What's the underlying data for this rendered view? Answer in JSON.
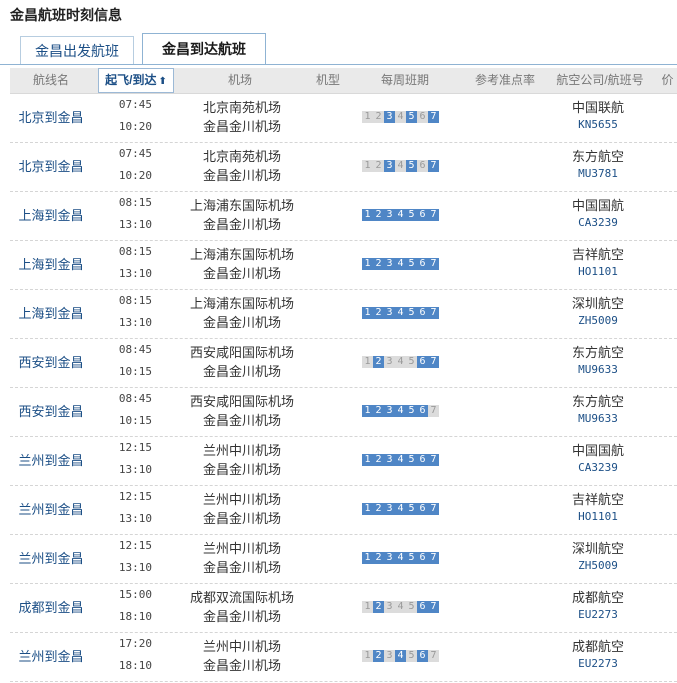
{
  "page_title": "金昌航班时刻信息",
  "tabs": [
    {
      "label": "金昌出发航班",
      "active": false
    },
    {
      "label": "金昌到达航班",
      "active": true
    }
  ],
  "columns": {
    "route": "航线名",
    "time": "起飞/到达",
    "airport": "机场",
    "plane": "机型",
    "weekly": "每周班期",
    "ontime": "参考准点率",
    "airline": "航空公司/航班号",
    "extra": "价"
  },
  "colors": {
    "accent": "#1c4f86",
    "day_on": "#4f86c6",
    "day_off": "#dcdcdc"
  },
  "flights": [
    {
      "route": "北京到金昌",
      "dep": "07:45",
      "arr": "10:20",
      "dep_airport": "北京南苑机场",
      "arr_airport": "金昌金川机场",
      "days": [
        0,
        0,
        1,
        0,
        1,
        0,
        1
      ],
      "airline": "中国联航",
      "flight_no": "KN5655"
    },
    {
      "route": "北京到金昌",
      "dep": "07:45",
      "arr": "10:20",
      "dep_airport": "北京南苑机场",
      "arr_airport": "金昌金川机场",
      "days": [
        0,
        0,
        1,
        0,
        1,
        0,
        1
      ],
      "airline": "东方航空",
      "flight_no": "MU3781"
    },
    {
      "route": "上海到金昌",
      "dep": "08:15",
      "arr": "13:10",
      "dep_airport": "上海浦东国际机场",
      "arr_airport": "金昌金川机场",
      "days": [
        1,
        1,
        1,
        1,
        1,
        1,
        1
      ],
      "airline": "中国国航",
      "flight_no": "CA3239"
    },
    {
      "route": "上海到金昌",
      "dep": "08:15",
      "arr": "13:10",
      "dep_airport": "上海浦东国际机场",
      "arr_airport": "金昌金川机场",
      "days": [
        1,
        1,
        1,
        1,
        1,
        1,
        1
      ],
      "airline": "吉祥航空",
      "flight_no": "HO1101"
    },
    {
      "route": "上海到金昌",
      "dep": "08:15",
      "arr": "13:10",
      "dep_airport": "上海浦东国际机场",
      "arr_airport": "金昌金川机场",
      "days": [
        1,
        1,
        1,
        1,
        1,
        1,
        1
      ],
      "airline": "深圳航空",
      "flight_no": "ZH5009"
    },
    {
      "route": "西安到金昌",
      "dep": "08:45",
      "arr": "10:15",
      "dep_airport": "西安咸阳国际机场",
      "arr_airport": "金昌金川机场",
      "days": [
        0,
        1,
        0,
        0,
        0,
        1,
        1
      ],
      "airline": "东方航空",
      "flight_no": "MU9633"
    },
    {
      "route": "西安到金昌",
      "dep": "08:45",
      "arr": "10:15",
      "dep_airport": "西安咸阳国际机场",
      "arr_airport": "金昌金川机场",
      "days": [
        1,
        1,
        1,
        1,
        1,
        1,
        0
      ],
      "airline": "东方航空",
      "flight_no": "MU9633"
    },
    {
      "route": "兰州到金昌",
      "dep": "12:15",
      "arr": "13:10",
      "dep_airport": "兰州中川机场",
      "arr_airport": "金昌金川机场",
      "days": [
        1,
        1,
        1,
        1,
        1,
        1,
        1
      ],
      "airline": "中国国航",
      "flight_no": "CA3239"
    },
    {
      "route": "兰州到金昌",
      "dep": "12:15",
      "arr": "13:10",
      "dep_airport": "兰州中川机场",
      "arr_airport": "金昌金川机场",
      "days": [
        1,
        1,
        1,
        1,
        1,
        1,
        1
      ],
      "airline": "吉祥航空",
      "flight_no": "HO1101"
    },
    {
      "route": "兰州到金昌",
      "dep": "12:15",
      "arr": "13:10",
      "dep_airport": "兰州中川机场",
      "arr_airport": "金昌金川机场",
      "days": [
        1,
        1,
        1,
        1,
        1,
        1,
        1
      ],
      "airline": "深圳航空",
      "flight_no": "ZH5009"
    },
    {
      "route": "成都到金昌",
      "dep": "15:00",
      "arr": "18:10",
      "dep_airport": "成都双流国际机场",
      "arr_airport": "金昌金川机场",
      "days": [
        0,
        1,
        0,
        0,
        0,
        1,
        1
      ],
      "airline": "成都航空",
      "flight_no": "EU2273"
    },
    {
      "route": "兰州到金昌",
      "dep": "17:20",
      "arr": "18:10",
      "dep_airport": "兰州中川机场",
      "arr_airport": "金昌金川机场",
      "days": [
        0,
        1,
        0,
        1,
        0,
        1,
        0
      ],
      "airline": "成都航空",
      "flight_no": "EU2273"
    }
  ]
}
